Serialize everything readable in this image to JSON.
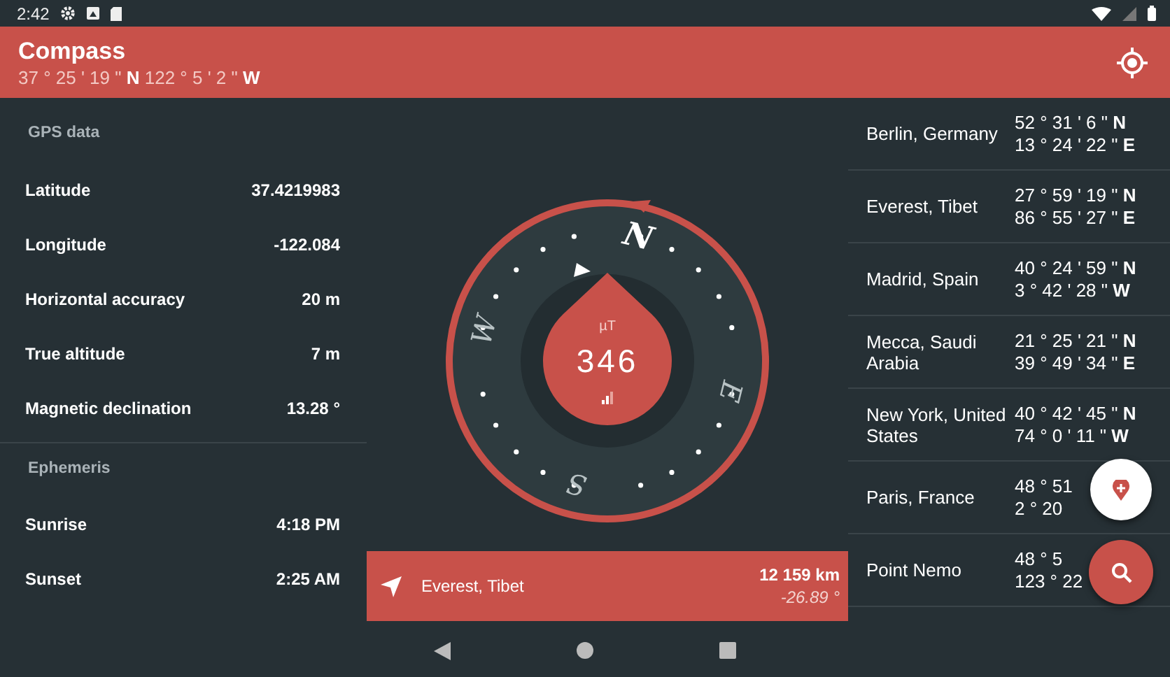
{
  "status_bar": {
    "time": "2:42"
  },
  "app_bar": {
    "title": "Compass",
    "subtitle": "37 ° 25 ' 19 \" **N** 122 ° 5 ' 2 \" **W**"
  },
  "info_sections": [
    {
      "title": "GPS data",
      "rows": [
        {
          "label": "Latitude",
          "value": "37.4219983"
        },
        {
          "label": "Longitude",
          "value": "-122.084"
        },
        {
          "label": "Horizontal accuracy",
          "value": "20 m"
        },
        {
          "label": "True altitude",
          "value": "7 m"
        },
        {
          "label": "Magnetic declination",
          "value": "13.28 °"
        }
      ]
    },
    {
      "title": "Ephemeris",
      "rows": [
        {
          "label": "Sunrise",
          "value": "4:18 PM"
        },
        {
          "label": "Sunset",
          "value": "2:25 AM"
        }
      ]
    }
  ],
  "compass": {
    "cardinals": [
      "N",
      "E",
      "S",
      "W"
    ],
    "unit": "µT",
    "reading": "346"
  },
  "target": {
    "name": "Everest, Tibet",
    "distance": "12 159 km",
    "bearing": "-26.89 °"
  },
  "places": [
    {
      "name": "Berlin, Germany",
      "lat": "52 ° 31 ' 6 \" **N**",
      "lon": "13 ° 24 ' 22 \" **E**"
    },
    {
      "name": "Everest, Tibet",
      "lat": "27 ° 59 ' 19 \" **N**",
      "lon": "86 ° 55 ' 27 \" **E**"
    },
    {
      "name": "Madrid, Spain",
      "lat": "40 ° 24 ' 59 \" **N**",
      "lon": "3 ° 42 ' 28 \" **W**"
    },
    {
      "name": "Mecca, Saudi Arabia",
      "lat": "21 ° 25 ' 21 \" **N**",
      "lon": "39 ° 49 ' 34 \" **E**"
    },
    {
      "name": "New York, United States",
      "lat": "40 ° 42 ' 45 \" **N**",
      "lon": "74 ° 0 ' 11 \" **W**"
    },
    {
      "name": "Paris, France",
      "lat": "48 ° 51",
      "lon": "2 ° 20"
    },
    {
      "name": "Point Nemo",
      "lat": "48 ° 5",
      "lon": "123 ° 22"
    }
  ]
}
